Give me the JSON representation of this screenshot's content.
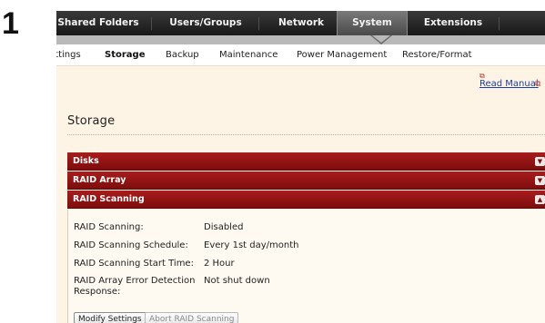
{
  "step": {
    "number": "1"
  },
  "top_nav": {
    "tabs": [
      {
        "label": "Shared Folders"
      },
      {
        "label": "Users/Groups"
      },
      {
        "label": "Network"
      },
      {
        "label": "System"
      },
      {
        "label": "Extensions"
      }
    ],
    "active": "System"
  },
  "sub_nav": {
    "tabs": [
      {
        "label": "ettings"
      },
      {
        "label": "Storage"
      },
      {
        "label": "Backup"
      },
      {
        "label": "Maintenance"
      },
      {
        "label": "Power Management"
      },
      {
        "label": "Restore/Format"
      }
    ],
    "active": "Storage"
  },
  "manual": {
    "label": "Read Manual",
    "icon": "external-link-icon"
  },
  "page": {
    "title": "Storage"
  },
  "sections": [
    {
      "title": "Disks",
      "expanded": false
    },
    {
      "title": "RAID Array",
      "expanded": false
    },
    {
      "title": "RAID Scanning",
      "expanded": true
    }
  ],
  "raid_scanning": {
    "rows": [
      {
        "label": "RAID Scanning:",
        "value": "Disabled"
      },
      {
        "label": "RAID Scanning Schedule:",
        "value": "Every 1st day/month"
      },
      {
        "label": "RAID Scanning Start Time:",
        "value": "2 Hour"
      },
      {
        "label": "RAID Array Error Detection Response:",
        "value": "Not shut down"
      }
    ],
    "buttons": {
      "modify": "Modify Settings",
      "abort": "Abort RAID Scanning"
    }
  },
  "colors": {
    "section_header": "#8e1414",
    "nav_bar": "#222222",
    "link": "#1d3f9c",
    "content_bg": "#fdf4e6"
  }
}
